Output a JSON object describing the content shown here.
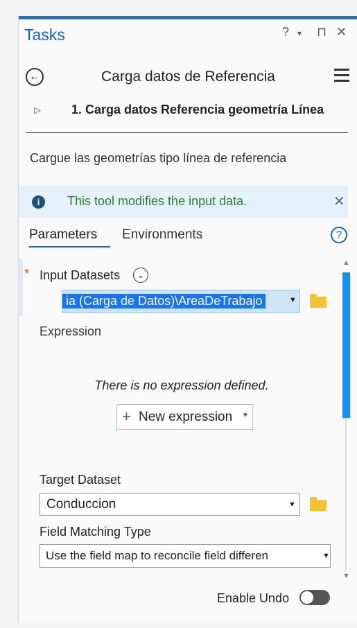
{
  "pane": {
    "title": "Tasks",
    "controls": [
      "?",
      "▾",
      "⊓",
      "✕"
    ]
  },
  "header": {
    "back_icon": "left-arrow-circle-icon",
    "task_title": "Carga datos de Referencia",
    "menu_icon": "hamburger-menu-icon"
  },
  "step": {
    "expand_glyph": "▷",
    "title": "1.  Carga datos Referencia geometría Línea"
  },
  "description": "Cargue las geometrías tipo línea de referencia",
  "info": {
    "icon": "i",
    "message": "This tool modifies the input data.",
    "close": "✕"
  },
  "tabs": {
    "parameters": "Parameters",
    "environments": "Environments",
    "help": "?"
  },
  "params": {
    "required_marker": "*",
    "input_label": "Input Datasets",
    "input_value": "ia (Carga de Datos)\\AreaDeTrabajo",
    "expression_label": "Expression",
    "no_expression": "There is no expression defined.",
    "new_expression": "New expression",
    "target_label": "Target Dataset",
    "target_value": "Conduccion",
    "field_matching_label": "Field Matching Type",
    "field_matching_value": "Use the field map to reconcile field differen"
  },
  "footer": {
    "enable_undo": "Enable Undo",
    "enable_undo_on": false
  },
  "colors": {
    "accent": "#1565c0",
    "info_bg": "#e6f2fb",
    "info_text": "#2e7d32",
    "required": "#e65100",
    "folder": "#f2c230"
  }
}
